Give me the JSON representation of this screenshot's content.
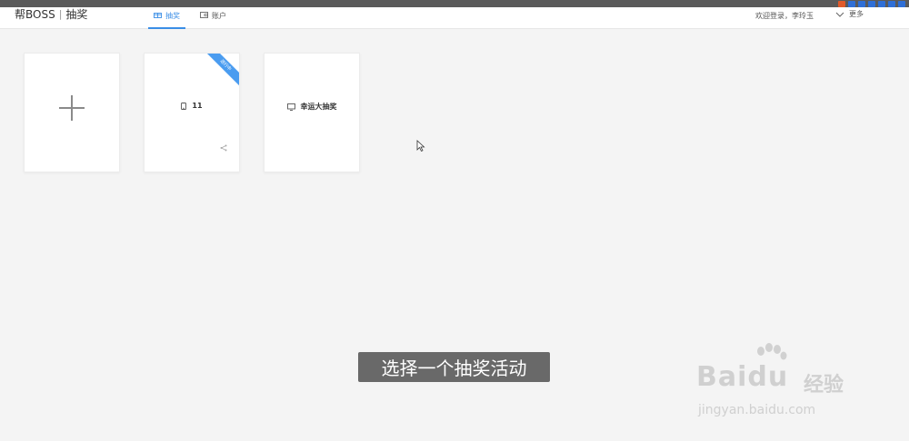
{
  "header": {
    "brand": "帮BOSS",
    "module": "抽奖",
    "nav": [
      {
        "label": "抽奖",
        "active": true,
        "icon": "gift-icon"
      },
      {
        "label": "账户",
        "active": false,
        "icon": "wallet-icon"
      }
    ],
    "user_greeting": "欢迎登录，李玲玉",
    "more_label": "更多"
  },
  "cards": [
    {
      "type": "add",
      "icon": "plus-icon"
    },
    {
      "type": "activity",
      "title": "11",
      "icon": "phone-icon",
      "ribbon": "进行中",
      "share_icon": "share-icon"
    },
    {
      "type": "activity",
      "title": "幸运大抽奖",
      "icon": "monitor-icon"
    }
  ],
  "caption": "选择一个抽奖活动",
  "watermark": {
    "brand_latin": "Bai",
    "brand_du": "du",
    "brand_cn": "经验",
    "url": "jingyan.baidu.com"
  },
  "colors": {
    "accent": "#3a8ee6",
    "ribbon": "#4a9cf0",
    "background": "#f4f4f4"
  }
}
